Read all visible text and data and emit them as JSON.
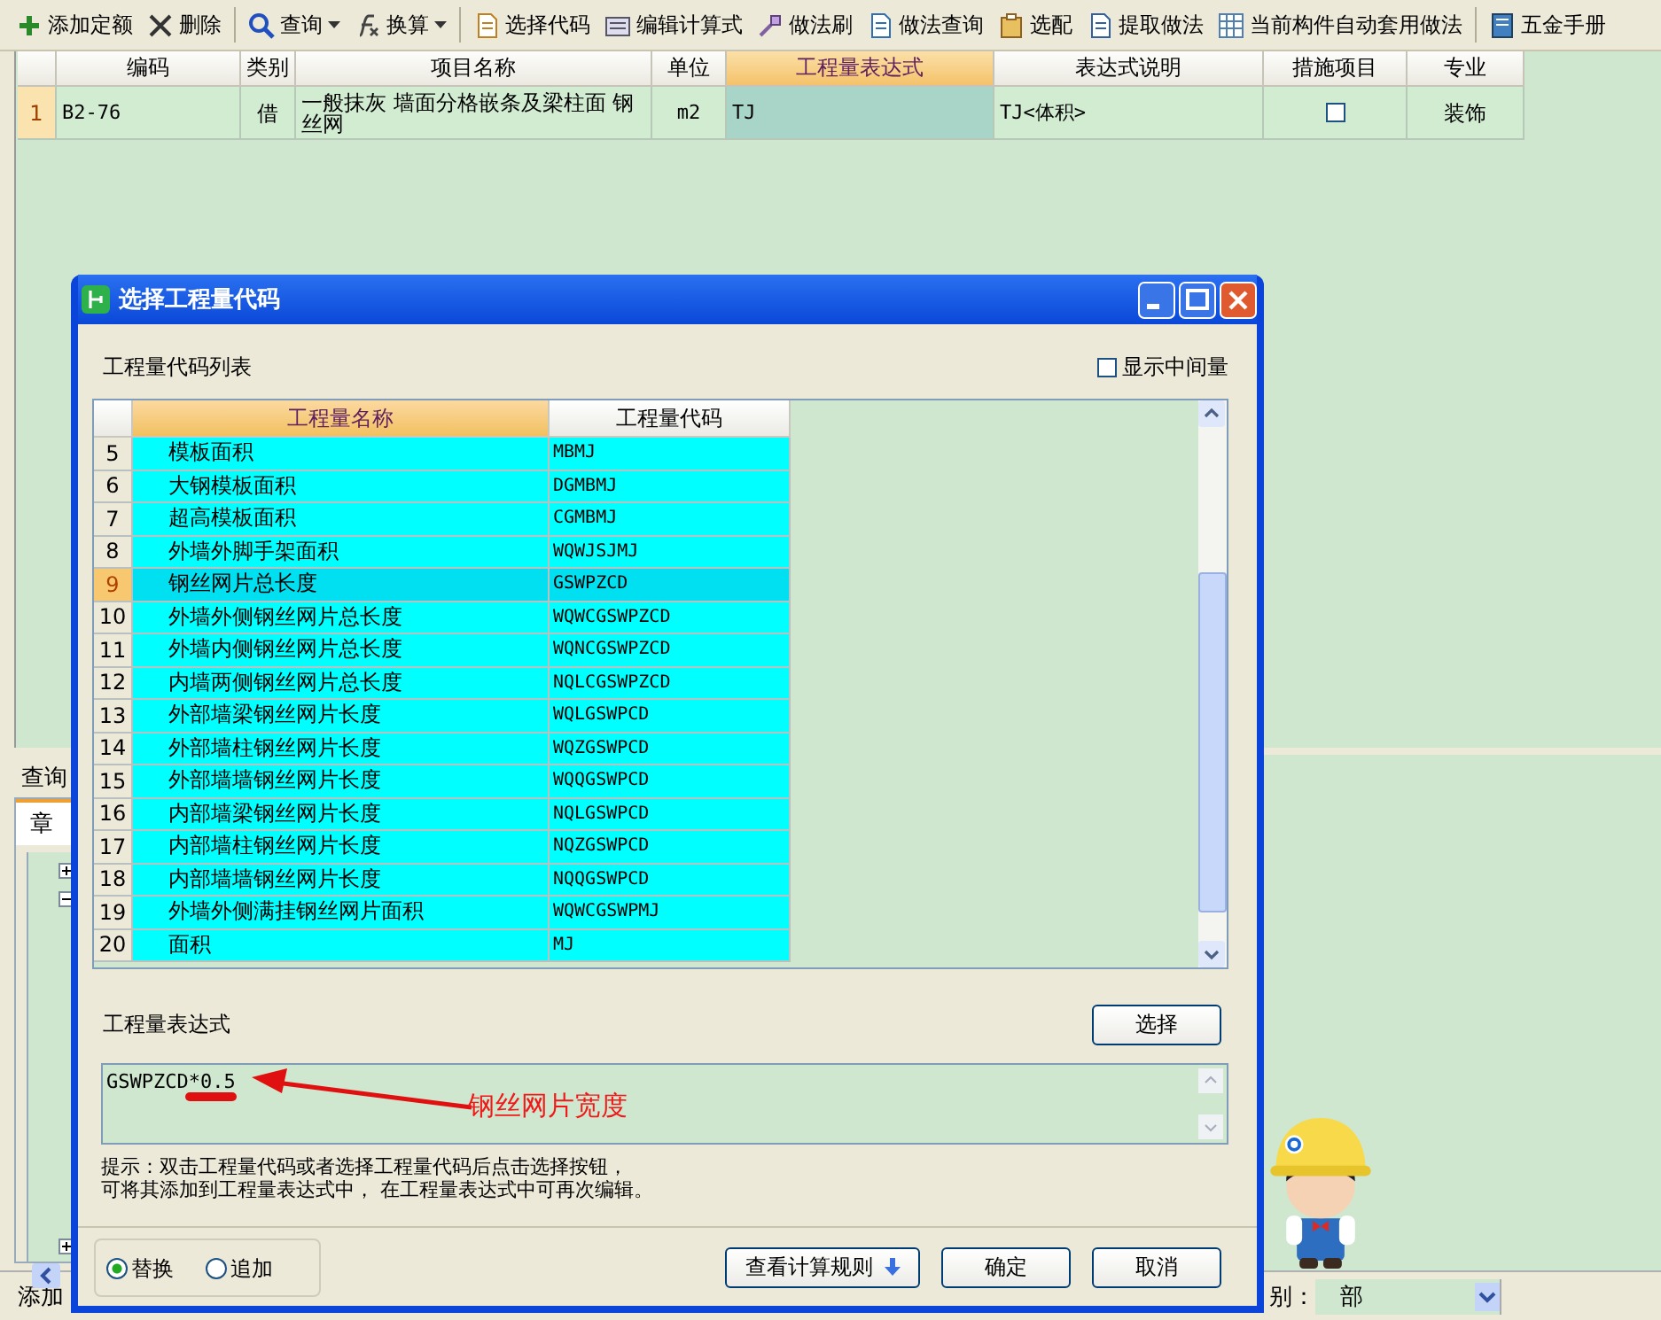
{
  "toolbar": [
    {
      "label": "添加定额",
      "dropdown": false
    },
    {
      "label": "删除",
      "dropdown": false
    },
    {
      "label": "查询",
      "dropdown": true
    },
    {
      "label": "换算",
      "dropdown": true
    },
    {
      "label": "选择代码",
      "dropdown": false
    },
    {
      "label": "编辑计算式",
      "dropdown": false
    },
    {
      "label": "做法刷",
      "dropdown": false
    },
    {
      "label": "做法查询",
      "dropdown": false
    },
    {
      "label": "选配",
      "dropdown": false
    },
    {
      "label": "提取做法",
      "dropdown": false
    },
    {
      "label": "当前构件自动套用做法",
      "dropdown": false
    },
    {
      "label": "五金手册",
      "dropdown": false
    }
  ],
  "main_table": {
    "columns": [
      {
        "label": "编码",
        "selected": false
      },
      {
        "label": "类别",
        "selected": false
      },
      {
        "label": "项目名称",
        "selected": false
      },
      {
        "label": "单位",
        "selected": false
      },
      {
        "label": "工程量表达式",
        "selected": true
      },
      {
        "label": "表达式说明",
        "selected": false
      },
      {
        "label": "措施项目",
        "selected": false
      },
      {
        "label": "专业",
        "selected": false
      }
    ],
    "rows": [
      {
        "number": "1",
        "code": "B2-76",
        "category": "借",
        "name": "一般抹灰 墙面分格嵌条及梁柱面 钢丝网",
        "unit": "m2",
        "expression": "TJ",
        "description": "TJ<体积>",
        "measure": false,
        "specialty": "装饰"
      }
    ]
  },
  "side_panel": {
    "tab": "查询",
    "subtab": "章",
    "tree_nodes": [
      {
        "expanded": false
      },
      {
        "expanded": true
      },
      {
        "expanded": false
      }
    ]
  },
  "status_bar": {
    "left": "添加",
    "filter_label": "别：",
    "filter_value": "部"
  },
  "dialog": {
    "title": "选择工程量代码",
    "list_label": "工程量代码列表",
    "show_intermediate": {
      "label": "显示中间量",
      "checked": false
    },
    "code_table": {
      "columns": [
        {
          "label": "工程量名称",
          "selected": true
        },
        {
          "label": "工程量代码",
          "selected": false
        }
      ],
      "rows": [
        {
          "number": "5",
          "name": "模板面积",
          "code": "MBMJ",
          "selected": false
        },
        {
          "number": "6",
          "name": "大钢模板面积",
          "code": "DGMBMJ",
          "selected": false
        },
        {
          "number": "7",
          "name": "超高模板面积",
          "code": "CGMBMJ",
          "selected": false
        },
        {
          "number": "8",
          "name": "外墙外脚手架面积",
          "code": "WQWJSJMJ",
          "selected": false
        },
        {
          "number": "9",
          "name": "钢丝网片总长度",
          "code": "GSWPZCD",
          "selected": true
        },
        {
          "number": "10",
          "name": "外墙外侧钢丝网片总长度",
          "code": "WQWCGSWPZCD",
          "selected": false
        },
        {
          "number": "11",
          "name": "外墙内侧钢丝网片总长度",
          "code": "WQNCGSWPZCD",
          "selected": false
        },
        {
          "number": "12",
          "name": "内墙两侧钢丝网片总长度",
          "code": "NQLCGSWPZCD",
          "selected": false
        },
        {
          "number": "13",
          "name": "外部墙梁钢丝网片长度",
          "code": "WQLGSWPCD",
          "selected": false
        },
        {
          "number": "14",
          "name": "外部墙柱钢丝网片长度",
          "code": "WQZGSWPCD",
          "selected": false
        },
        {
          "number": "15",
          "name": "外部墙墙钢丝网片长度",
          "code": "WQQGSWPCD",
          "selected": false
        },
        {
          "number": "16",
          "name": "内部墙梁钢丝网片长度",
          "code": "NQLGSWPCD",
          "selected": false
        },
        {
          "number": "17",
          "name": "内部墙柱钢丝网片长度",
          "code": "NQZGSWPCD",
          "selected": false
        },
        {
          "number": "18",
          "name": "内部墙墙钢丝网片长度",
          "code": "NQQGSWPCD",
          "selected": false
        },
        {
          "number": "19",
          "name": "外墙外侧满挂钢丝网片面积",
          "code": "WQWCGSWPMJ",
          "selected": false
        },
        {
          "number": "20",
          "name": "面积",
          "code": "MJ",
          "selected": false
        }
      ]
    },
    "expression_label": "工程量表达式",
    "select_button": "选择",
    "expression_value": "GSWPZCD*0.5",
    "annotation": "钢丝网片宽度",
    "hint": [
      "提示：双击工程量代码或者选择工程量代码后点击选择按钮，",
      "可将其添加到工程量表达式中， 在工程量表达式中可再次编辑。"
    ],
    "mode_options": [
      {
        "label": "替换",
        "selected": true
      },
      {
        "label": "追加",
        "selected": false
      }
    ],
    "buttons": [
      {
        "label": "查看计算规则",
        "kind": "expand"
      },
      {
        "label": "确定",
        "kind": "plain"
      },
      {
        "label": "取消",
        "kind": "plain"
      }
    ]
  }
}
